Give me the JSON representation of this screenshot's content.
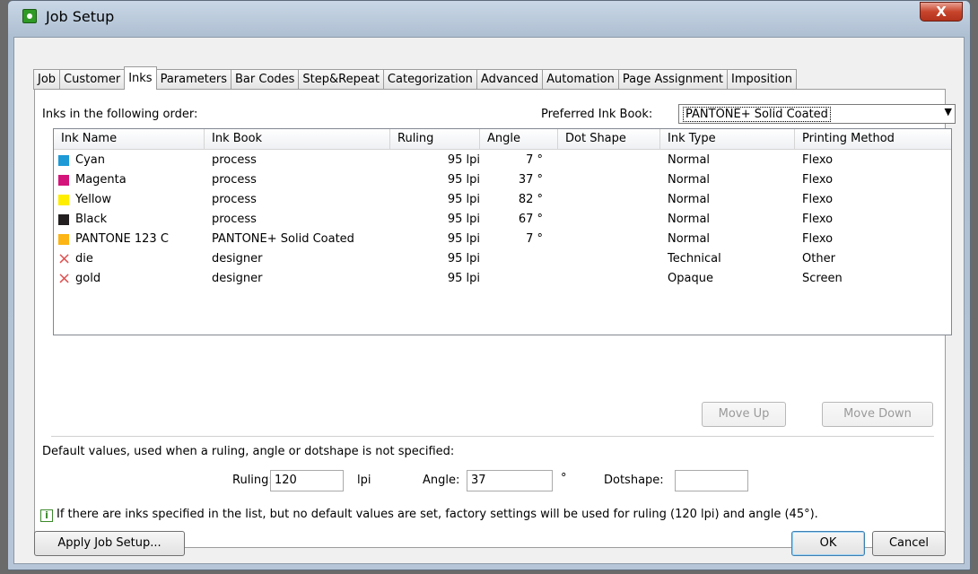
{
  "window": {
    "title": "Job Setup",
    "close_label": "X"
  },
  "tabs": [
    {
      "label": "Job"
    },
    {
      "label": "Customer"
    },
    {
      "label": "Inks",
      "active": true
    },
    {
      "label": "Parameters"
    },
    {
      "label": "Bar Codes"
    },
    {
      "label": "Step&Repeat"
    },
    {
      "label": "Categorization"
    },
    {
      "label": "Advanced"
    },
    {
      "label": "Automation"
    },
    {
      "label": "Page Assignment"
    },
    {
      "label": "Imposition"
    }
  ],
  "inks_panel": {
    "order_label": "Inks in the following order:",
    "preferred_ink_book_label": "Preferred Ink Book:",
    "preferred_ink_book_value": "PANTONE+ Solid Coated",
    "dropdown_arrow": "▼",
    "columns": [
      "Ink Name",
      "Ink Book",
      "Ruling",
      "Angle",
      "Dot Shape",
      "Ink Type",
      "Printing Method"
    ],
    "rows": [
      {
        "marker": "swatch",
        "color": "#1e9ad6",
        "name": "Cyan",
        "book": "process",
        "ruling": "95 lpi",
        "angle": "7 °",
        "dot_shape": "",
        "ink_type": "Normal",
        "method": "Flexo"
      },
      {
        "marker": "swatch",
        "color": "#d4147a",
        "name": "Magenta",
        "book": "process",
        "ruling": "95 lpi",
        "angle": "37 °",
        "dot_shape": "",
        "ink_type": "Normal",
        "method": "Flexo"
      },
      {
        "marker": "swatch",
        "color": "#ffee00",
        "name": "Yellow",
        "book": "process",
        "ruling": "95 lpi",
        "angle": "82 °",
        "dot_shape": "",
        "ink_type": "Normal",
        "method": "Flexo"
      },
      {
        "marker": "swatch",
        "color": "#231f20",
        "name": "Black",
        "book": "process",
        "ruling": "95 lpi",
        "angle": "67 °",
        "dot_shape": "",
        "ink_type": "Normal",
        "method": "Flexo"
      },
      {
        "marker": "swatch",
        "color": "#fcb514",
        "name": "PANTONE 123 C",
        "book": "PANTONE+ Solid Coated",
        "ruling": "95 lpi",
        "angle": "7 °",
        "dot_shape": "",
        "ink_type": "Normal",
        "method": "Flexo"
      },
      {
        "marker": "x",
        "color": "#e05050",
        "name": "die",
        "book": "designer",
        "ruling": "95 lpi",
        "angle": "",
        "dot_shape": "",
        "ink_type": "Technical",
        "method": "Other"
      },
      {
        "marker": "x",
        "color": "#e05050",
        "name": "gold",
        "book": "designer",
        "ruling": "95 lpi",
        "angle": "",
        "dot_shape": "",
        "ink_type": "Opaque",
        "method": "Screen"
      }
    ],
    "move_up_label": "Move Up",
    "move_down_label": "Move Down",
    "defaults_label": "Default values, used when a ruling, angle or dotshape is not specified:",
    "ruling_label": "Ruling:",
    "ruling_value": "120",
    "ruling_unit": "lpi",
    "angle_label": "Angle:",
    "angle_value": "37",
    "angle_unit": "°",
    "dotshape_label": "Dotshape:",
    "dotshape_value": "",
    "info_icon": "i",
    "info_text": "If there are inks specified in the list, but no default values are set, factory settings will be used for ruling (120 lpi) and angle (45°)."
  },
  "footer": {
    "apply_label": "Apply Job Setup...",
    "ok_label": "OK",
    "cancel_label": "Cancel"
  }
}
